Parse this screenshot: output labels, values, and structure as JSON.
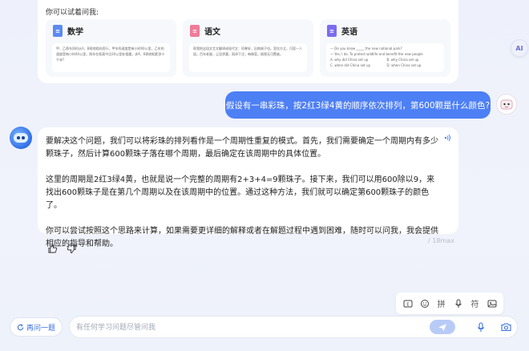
{
  "suggestions": {
    "title": "你可以试着问我:",
    "math": {
      "name": "数学",
      "body": "甲、乙两车同时从A、B两地相向而行，甲车的速度是每小时60公里，乙车的速度是每小时40公里，两车在距离中点20公里处相遇，求A、B两地相距多少千米?"
    },
    "chinese": {
      "name": "语文",
      "body": "帮我把这段文言文翻译成现代文：项脊轩，旧南阁子也。室仅方丈，可容一人居。百年老屋，尘泥渗漉，雨泽下注；每移案，顾视无可置者。"
    },
    "english": {
      "name": "英语",
      "question": "— Do you know _____ the new national park?",
      "answer_line": "— Yes, I do. To protect wildlife and benefit the new people",
      "options": [
        "A. why did China set up",
        "B. why China set up",
        "C. when did China set up",
        "D. when China set up"
      ]
    }
  },
  "ai_badge": "AI",
  "user_message": "假设有一串彩珠，按2红3绿4黄的顺序依次排列，第600颗是什么颜色?",
  "answer": {
    "p1": "要解决这个问题，我们可以将彩珠的排列看作是一个周期性重复的模式。首先，我们需要确定一个周期内有多少颗珠子，然后计算600颗珠子落在哪个周期，最后确定在该周期中的具体位置。",
    "p2": "这里的周期是2红3绿4黄，也就是说一个完整的周期有2+3+4=9颗珠子。接下来，我们可以用600除以9，来找出600颗珠子是在第几个周期以及在该周期中的位置。通过这种方法，我们就可以确定第600颗珠子的颜色了。",
    "p3": "你可以尝试按照这个思路来计算，如果需要更详细的解释或者在解题过程中遇到困难，随时可以问我，我会提供相应的指导和帮助。"
  },
  "meta": "/ 18max",
  "toolbar": {
    "pinyin": "拼",
    "fu": "符"
  },
  "new_topic": "再问一题",
  "input": {
    "placeholder": "有任何学习问题尽管问我",
    "value": ""
  },
  "colors": {
    "accent": "#4d7ff5",
    "math": "#5b8bf0",
    "chinese": "#f07a9a",
    "english": "#7b6cf0"
  },
  "icons": [
    "book-icon",
    "speaker-icon",
    "thumb-up-icon",
    "thumb-down-icon",
    "keyboard-icon",
    "emoji-icon",
    "mic-icon",
    "image-icon",
    "send-icon",
    "camera-icon",
    "refresh-icon"
  ]
}
